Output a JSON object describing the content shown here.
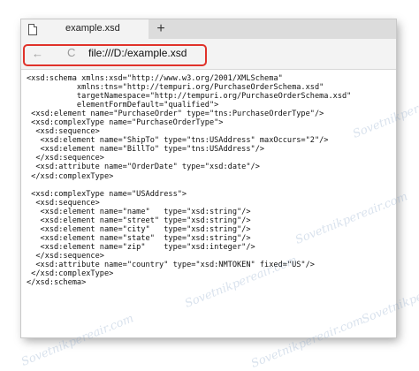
{
  "browser": {
    "tab_title": "example.xsd",
    "new_tab_glyph": "+",
    "address": "file:///D:/example.xsd",
    "back_glyph": "←",
    "reload_glyph": "C",
    "highlight_color": "#e0322a"
  },
  "document": {
    "lines": [
      "<xsd:schema xmlns:xsd=\"http://www.w3.org/2001/XMLSchema\"",
      "           xmlns:tns=\"http://tempuri.org/PurchaseOrderSchema.xsd\"",
      "           targetNamespace=\"http://tempuri.org/PurchaseOrderSchema.xsd\"",
      "           elementFormDefault=\"qualified\">",
      " <xsd:element name=\"PurchaseOrder\" type=\"tns:PurchaseOrderType\"/>",
      " <xsd:complexType name=\"PurchaseOrderType\">",
      "  <xsd:sequence>",
      "   <xsd:element name=\"ShipTo\" type=\"tns:USAddress\" maxOccurs=\"2\"/>",
      "   <xsd:element name=\"BillTo\" type=\"tns:USAddress\"/>",
      "  </xsd:sequence>",
      "  <xsd:attribute name=\"OrderDate\" type=\"xsd:date\"/>",
      " </xsd:complexType>",
      "",
      " <xsd:complexType name=\"USAddress\">",
      "  <xsd:sequence>",
      "   <xsd:element name=\"name\"   type=\"xsd:string\"/>",
      "   <xsd:element name=\"street\" type=\"xsd:string\"/>",
      "   <xsd:element name=\"city\"   type=\"xsd:string\"/>",
      "   <xsd:element name=\"state\"  type=\"xsd:string\"/>",
      "   <xsd:element name=\"zip\"    type=\"xsd:integer\"/>",
      "  </xsd:sequence>",
      "  <xsd:attribute name=\"country\" type=\"xsd:NMTOKEN\" fixed=\"US\"/>",
      " </xsd:complexType>",
      "</xsd:schema>"
    ]
  },
  "watermark": {
    "text": "Sovetnikpereair.com"
  }
}
